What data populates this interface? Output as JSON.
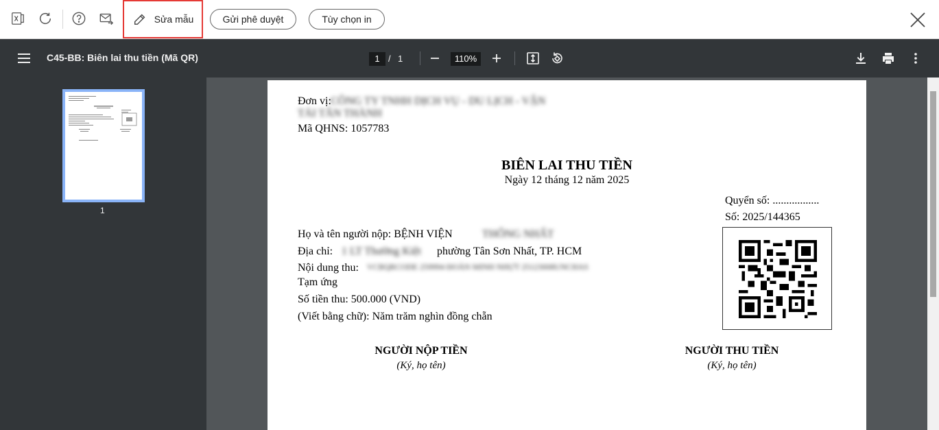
{
  "app_toolbar": {
    "edit_template_label": "Sửa mẫu",
    "send_approval_label": "Gửi phê duyệt",
    "print_options_label": "Tùy chọn in"
  },
  "viewer": {
    "title": "C45-BB: Biên lai thu tiền (Mã QR)",
    "current_page": "1",
    "page_separator": "/",
    "total_pages": "1",
    "zoom": "110%",
    "thumbnail_label": "1"
  },
  "document": {
    "unit_label": "Đơn vị:",
    "unit_name_line1": "CÔNG TY TNHH DỊCH VỤ - DU LỊCH - VẬN",
    "unit_name_line2": "TẢI TÂN THÀNH",
    "qhns": "Mã QHNS: 1057783",
    "title": "BIÊN LAI THU TIỀN",
    "date": "Ngày 12 tháng 12 năm 2025",
    "book_no": "Quyển số: .................",
    "receipt_no": "Số: 2025/144365",
    "payer_label": "Họ và tên người nộp: BỆNH VIỆN",
    "payer_hidden": "THỐNG NHẤT",
    "address_label": "Địa chỉ:",
    "address_hidden": "1 LT Thường Kiệt",
    "address_visible": "phường Tân Sơn Nhất, TP. HCM",
    "content_label": "Nội dung thu:",
    "content_hidden": "VCBQRCODE 259994 ĐOÀN MINH NHỰT 25123008UNCHAS",
    "content_line2": "Tạm ứng",
    "amount": "Số tiền thu: 500.000 (VND)",
    "amount_words": "(Viết bằng chữ): Năm trăm nghìn đồng chẵn",
    "payer_sign_title": "NGƯỜI NỘP TIỀN",
    "payer_sign_note": "(Ký, họ tên)",
    "collector_sign_title": "NGƯỜI THU TIỀN",
    "collector_sign_note": "(Ký, họ tên)"
  },
  "icons": {
    "excel": "excel-icon",
    "refresh": "refresh-icon",
    "help": "help-icon",
    "email": "email-send-icon",
    "edit": "pencil-icon",
    "close": "close-icon"
  },
  "colors": {
    "highlight": "#e53935",
    "viewer_bg": "#323639",
    "canvas_bg": "#525659",
    "thumb_border": "#8ab4f8"
  }
}
